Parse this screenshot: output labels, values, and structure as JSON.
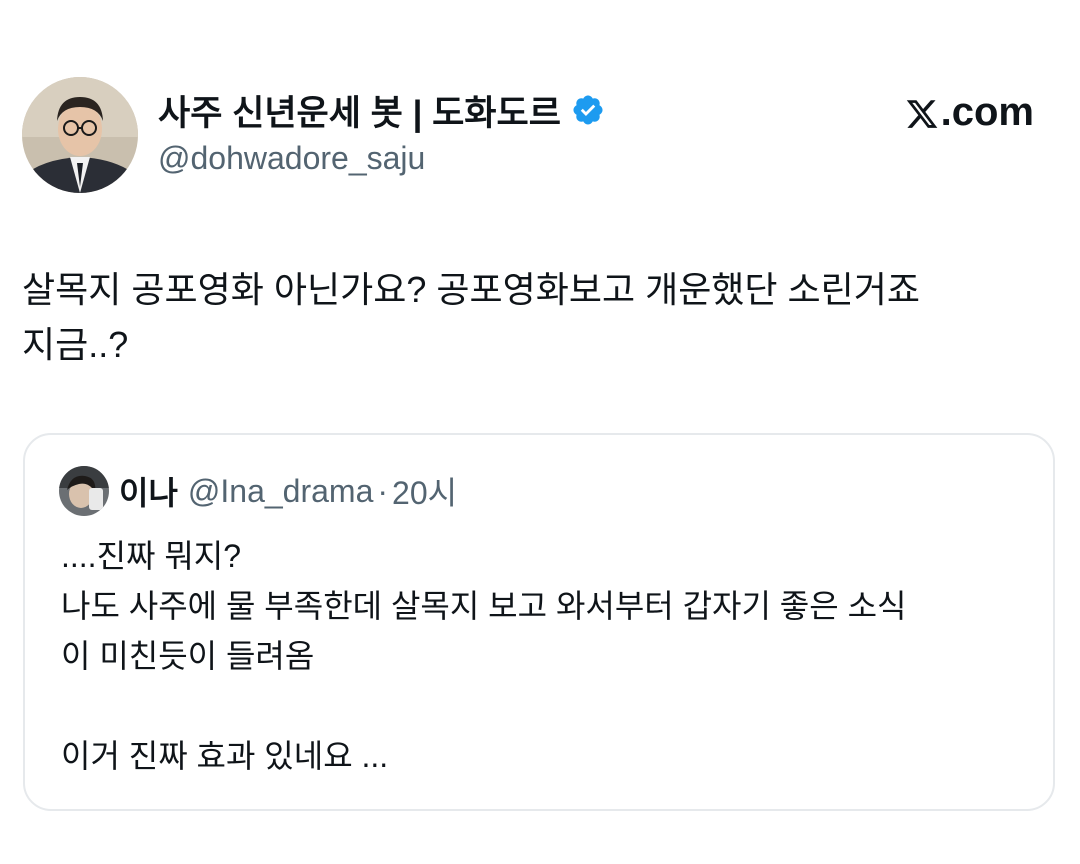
{
  "author": {
    "display_name": "사주 신년운세 봇 | 도화도르",
    "handle": "@dohwadore_saju",
    "verified": true,
    "avatar": "profile-photo-man-glasses"
  },
  "brand": {
    "label": ".com",
    "logo": "x-logo-icon"
  },
  "tweet": {
    "lines": [
      "살목지 공포영화 아닌가요? 공포영화보고 개운했단 소린거죠",
      "지금..?"
    ]
  },
  "quote": {
    "name": "이나",
    "handle": "@Ina_drama",
    "separator": "·",
    "time": "20시",
    "avatar": "profile-photo-small",
    "lines": [
      "....진짜 뭐지?",
      "나도 사주에 물 부족한데 살목지 보고 와서부터 갑자기 좋은 소식",
      "이 미친듯이 들려옴",
      "",
      "이거 진짜 효과 있네요 ..."
    ]
  },
  "colors": {
    "verified_blue": "#1d9bf0",
    "text_primary": "#0f1419",
    "text_secondary": "#536471",
    "card_border": "#e6e9ec"
  }
}
